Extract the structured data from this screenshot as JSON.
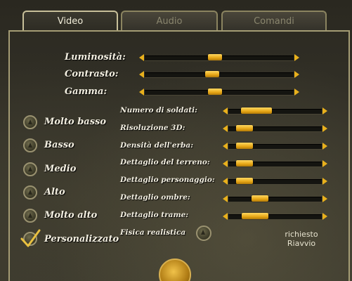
{
  "tabs": [
    {
      "label": "Video",
      "active": true
    },
    {
      "label": "Audio",
      "active": false
    },
    {
      "label": "Comandi",
      "active": false
    }
  ],
  "display_sliders": [
    {
      "label": "Luminosità:",
      "value": 0.47
    },
    {
      "label": "Contrasto:",
      "value": 0.45
    },
    {
      "label": "Gamma:",
      "value": 0.47
    }
  ],
  "presets": [
    {
      "label": "Molto basso",
      "selected": false
    },
    {
      "label": "Basso",
      "selected": false
    },
    {
      "label": "Medio",
      "selected": false
    },
    {
      "label": "Alto",
      "selected": false
    },
    {
      "label": "Molto alto",
      "selected": false
    },
    {
      "label": "Personalizzato",
      "selected": true
    }
  ],
  "detail_sliders": [
    {
      "label": "Numero di soldati:",
      "value": 0.2
    },
    {
      "label": "Risoluzione 3D:",
      "value": 0.1
    },
    {
      "label": "Densità dell'erba:",
      "value": 0.1
    },
    {
      "label": "Dettaglio del terreno:",
      "value": 0.1
    },
    {
      "label": "Dettaglio personaggio:",
      "value": 0.1
    },
    {
      "label": "Dettaglio ombre:",
      "value": 0.3
    },
    {
      "label": "Dettaglio trame:",
      "value": 0.2
    }
  ],
  "physics": {
    "label": "Fisica realistica",
    "enabled": false
  },
  "restart_note": {
    "line1": "richiesto",
    "line2": "Riavvio"
  },
  "colors": {
    "accent": "#e8b01c",
    "text": "#f2eee0",
    "frame": "#a49c74"
  }
}
